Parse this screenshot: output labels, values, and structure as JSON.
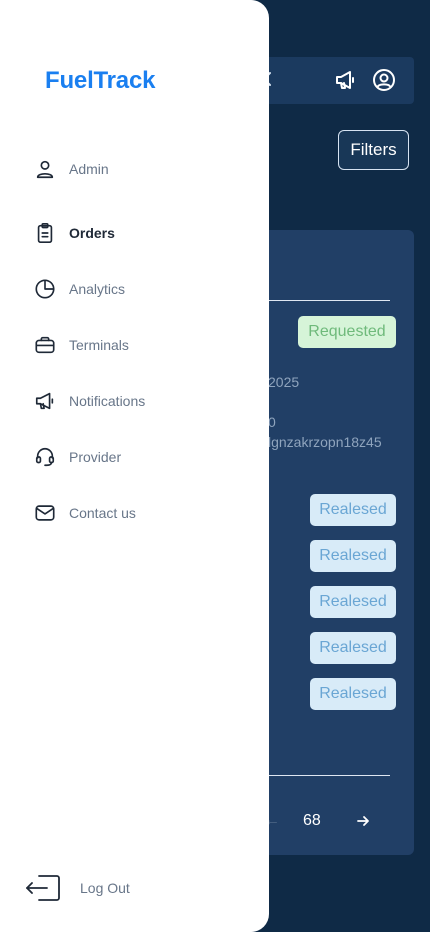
{
  "app": {
    "brand": "FuelTrack"
  },
  "topbar": {
    "icons": {
      "back": "close-icon",
      "notifications": "megaphone-icon",
      "profile": "user-circle-icon"
    }
  },
  "filters": {
    "label": "Filters"
  },
  "card": {
    "status_primary": "Requested",
    "date_fragment": "2025",
    "value_fragment": "0",
    "id_fragment": "lgnzakrzopn18z45",
    "released_badges": [
      "Realesed",
      "Realesed",
      "Realesed",
      "Realesed",
      "Realesed"
    ],
    "page_number": "68",
    "pager_prev": "←",
    "pager_next_icon": "arrow-right-icon"
  },
  "drawer": {
    "items": [
      {
        "label": "Admin",
        "icon": "user-icon",
        "active": false
      },
      {
        "label": "Orders",
        "icon": "clipboard-icon",
        "active": true
      },
      {
        "label": "Analytics",
        "icon": "pie-chart-icon",
        "active": false
      },
      {
        "label": "Terminals",
        "icon": "briefcase-icon",
        "active": false
      },
      {
        "label": "Notifications",
        "icon": "megaphone-icon",
        "active": false
      },
      {
        "label": "Provider",
        "icon": "headset-icon",
        "active": false
      },
      {
        "label": "Contact us",
        "icon": "mail-icon",
        "active": false
      }
    ],
    "logout_label": "Log Out",
    "logout_icon": "logout-icon"
  },
  "colors": {
    "background": "#0f2a46",
    "card": "#213f66",
    "brand": "#1a7ff0",
    "requested_bg": "#d6f4d8",
    "released_bg": "#d8ebf8"
  }
}
